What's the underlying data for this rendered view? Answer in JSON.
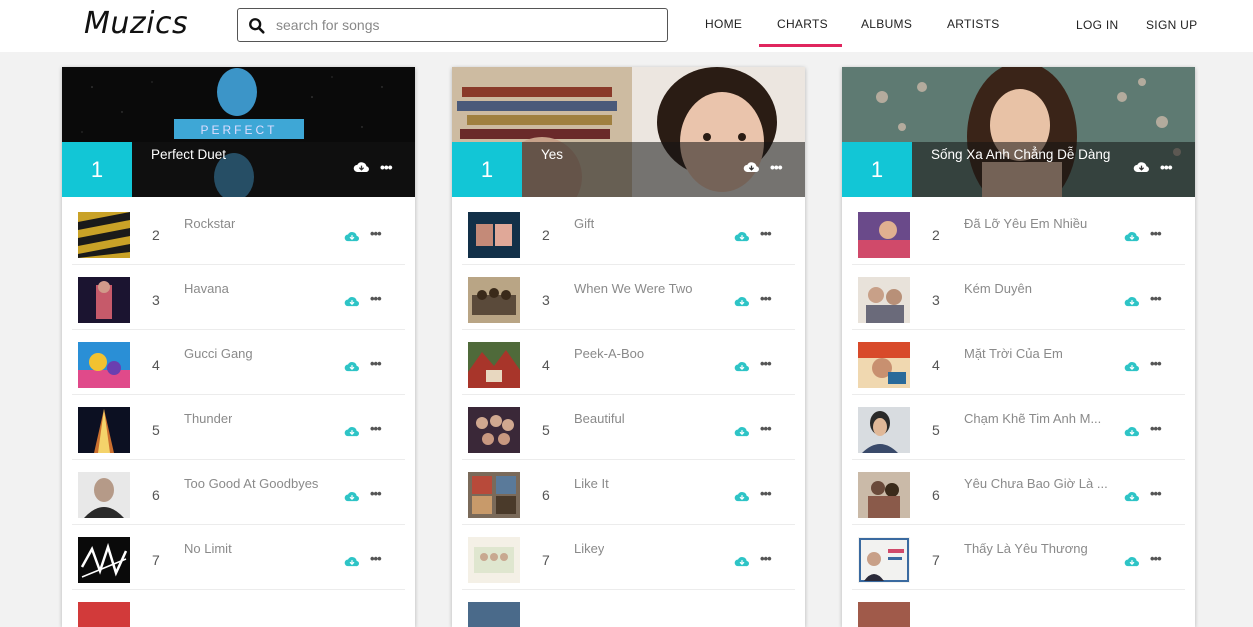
{
  "header": {
    "logo": "Muzics",
    "search_placeholder": "search for songs",
    "nav": [
      "HOME",
      "CHARTS",
      "ALBUMS",
      "ARTISTS"
    ],
    "login": "LOG IN",
    "signup": "SIGN UP",
    "active_nav": "CHARTS",
    "accent": "#e0265e"
  },
  "colors": {
    "rank_box": "#12c6d6",
    "cloud_icon": "#2ec4c6"
  },
  "charts": [
    {
      "top": {
        "rank": "1",
        "title": "Perfect Duet"
      },
      "items": [
        {
          "rank": "2",
          "title": "Rockstar"
        },
        {
          "rank": "3",
          "title": "Havana"
        },
        {
          "rank": "4",
          "title": "Gucci Gang"
        },
        {
          "rank": "5",
          "title": "Thunder"
        },
        {
          "rank": "6",
          "title": "Too Good At Goodbyes"
        },
        {
          "rank": "7",
          "title": "No Limit"
        }
      ]
    },
    {
      "top": {
        "rank": "1",
        "title": "Yes"
      },
      "items": [
        {
          "rank": "2",
          "title": "Gift"
        },
        {
          "rank": "3",
          "title": "When We Were Two"
        },
        {
          "rank": "4",
          "title": "Peek-A-Boo"
        },
        {
          "rank": "5",
          "title": "Beautiful"
        },
        {
          "rank": "6",
          "title": "Like It"
        },
        {
          "rank": "7",
          "title": "Likey"
        }
      ]
    },
    {
      "top": {
        "rank": "1",
        "title": "Sống Xa Anh Chẳng Dễ Dàng"
      },
      "items": [
        {
          "rank": "2",
          "title": "Đã Lỡ Yêu Em Nhiều"
        },
        {
          "rank": "3",
          "title": "Kém Duyên"
        },
        {
          "rank": "4",
          "title": "Mặt Trời Của Em"
        },
        {
          "rank": "5",
          "title": "Chạm Khẽ Tim Anh M..."
        },
        {
          "rank": "6",
          "title": "Yêu Chưa Bao Giờ Là ..."
        },
        {
          "rank": "7",
          "title": "Thấy Là Yêu Thương"
        }
      ]
    }
  ]
}
